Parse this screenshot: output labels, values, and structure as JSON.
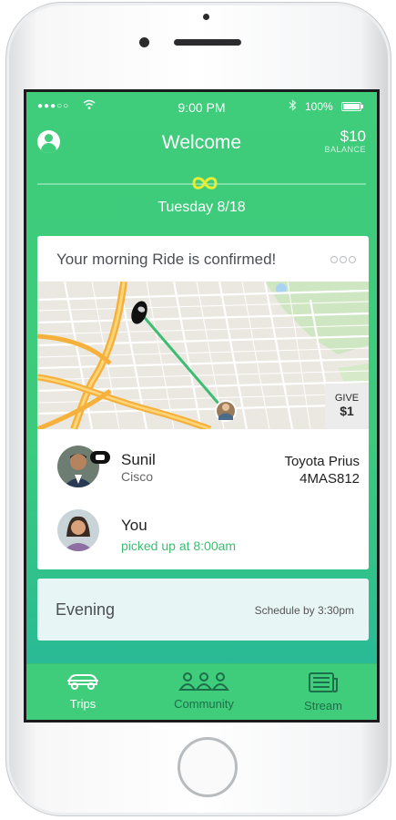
{
  "status_bar": {
    "signal": "●●●○○",
    "wifi": "wifi",
    "time": "9:00 PM",
    "bluetooth": "bluetooth",
    "battery_pct": "100%",
    "battery_fill": 1.0
  },
  "header": {
    "title": "Welcome",
    "balance_amount": "$10",
    "balance_label": "BALANCE"
  },
  "date": "Tuesday 8/18",
  "ride_card": {
    "title": "Your morning Ride is confirmed!",
    "give_label": "GIVE",
    "give_amount": "$1",
    "driver": {
      "name": "Sunil",
      "company": "Cisco",
      "car_model": "Toyota Prius",
      "plate": "4MAS812"
    },
    "rider": {
      "name": "You",
      "status": "picked up at 8:00am"
    }
  },
  "evening_card": {
    "label": "Evening",
    "schedule": "Schedule by 3:30pm"
  },
  "tabs": [
    {
      "label": "Trips",
      "icon": "car-icon",
      "active": true
    },
    {
      "label": "Community",
      "icon": "people-icon",
      "active": false
    },
    {
      "label": "Stream",
      "icon": "newspaper-icon",
      "active": false
    }
  ],
  "colors": {
    "brand_green": "#3fcc7b",
    "accent_yellow": "#e5ee37",
    "teal": "#24b59c"
  }
}
